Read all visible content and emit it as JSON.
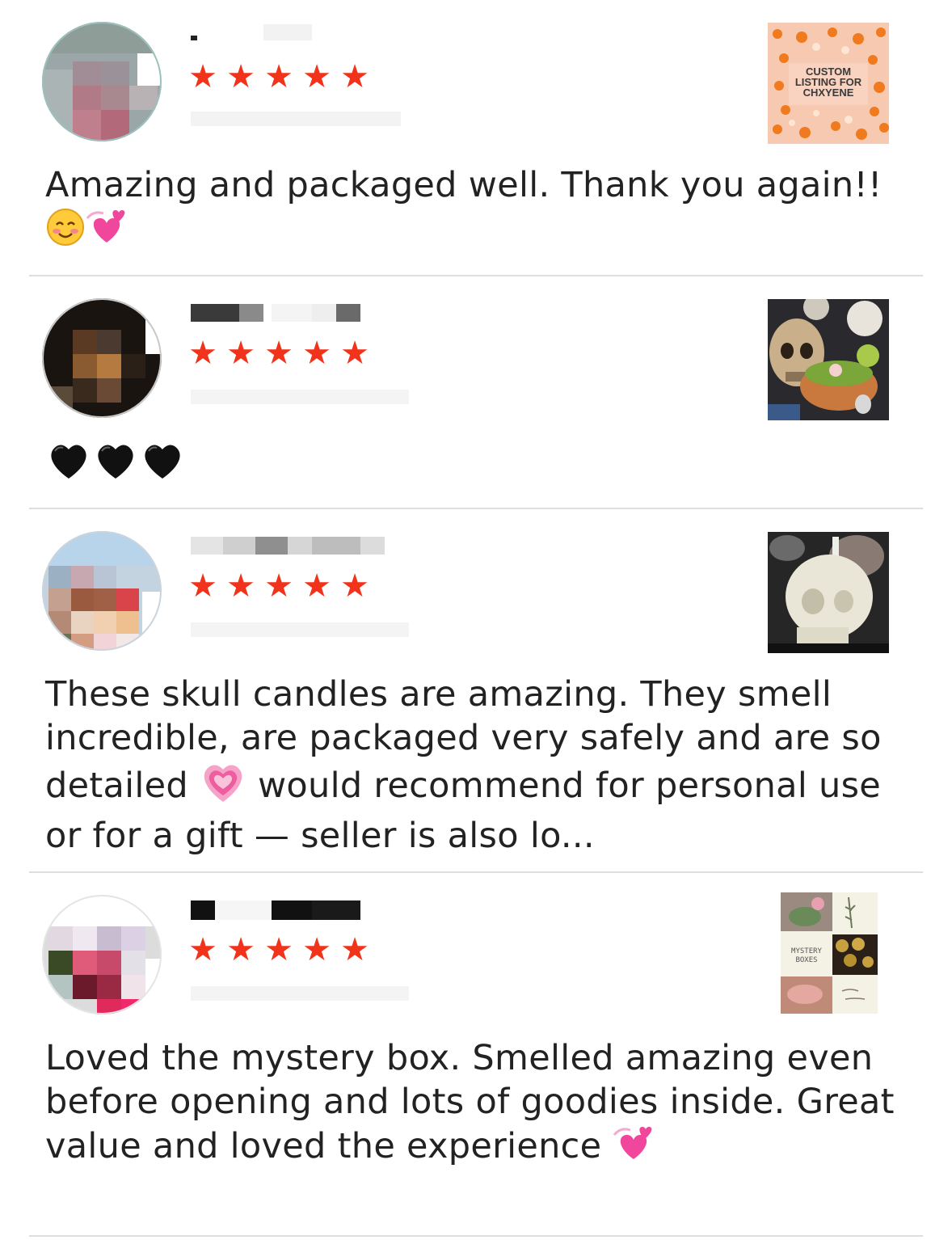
{
  "reviews": [
    {
      "rating": 5,
      "stars": "★★★★★",
      "text": "Amazing and packaged well. Thank you again!! ☺️💞",
      "text_main": "Amazing and packaged well. Thank you again!!",
      "thumbnail_label": "CUSTOM LISTING FOR CHXYENE",
      "emojis": [
        "smiling-face-icon",
        "revolving-hearts-icon"
      ]
    },
    {
      "rating": 5,
      "stars": "★★★★★",
      "text": "🖤🖤🖤",
      "emojis": [
        "black-heart-icon",
        "black-heart-icon",
        "black-heart-icon"
      ]
    },
    {
      "rating": 5,
      "stars": "★★★★★",
      "text": "These skull candles are amazing. They smell incredible, are packaged very safely and are so detailed 💗 would recommend for personal use or for a gift — seller is also lo...",
      "text_part1": "These skull candles are amazing. They smell incredible, are packaged very safely and are so detailed",
      "text_part2": "would recommend for personal use or for a gift — seller is also lo...",
      "emojis": [
        "growing-heart-icon"
      ]
    },
    {
      "rating": 5,
      "stars": "★★★★★",
      "text": "Loved the mystery box. Smelled amazing even before opening and lots of goodies inside. Great value and loved the experience 💞",
      "text_main": "Loved the mystery box. Smelled amazing even before opening and lots of goodies inside. Great value and loved the experience",
      "thumbnail_label": "MYSTERY BOXES",
      "emojis": [
        "revolving-hearts-icon"
      ]
    }
  ],
  "colors": {
    "star": "#f1331b",
    "text": "#222222",
    "divider": "#dedede",
    "thumb1_bg": "#f7c9b0",
    "pumpkin": "#f07a1e"
  }
}
